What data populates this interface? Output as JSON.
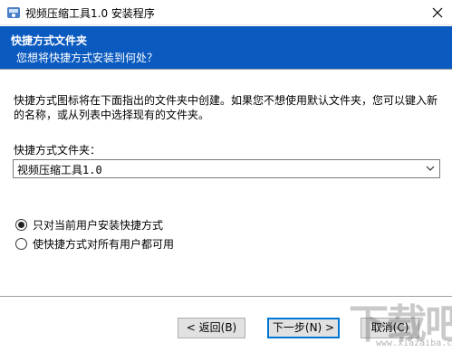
{
  "window": {
    "title": "视频压缩工具1.0 安装程序"
  },
  "header": {
    "title": "快捷方式文件夹",
    "subtitle": "您想将快捷方式安装到何处？",
    "background_color": "#0a5abf"
  },
  "body": {
    "description": "快捷方式图标将在下面指出的文件夹中创建。如果您不想使用默认文件夹，您可以键入新的名称，或从列表中选择现有的文件夹。",
    "folder_label": "快捷方式文件夹：",
    "folder_value": "视频压缩工具1.0",
    "radio_options": [
      {
        "label": "只对当前用户安装快捷方式",
        "checked": true
      },
      {
        "label": "使快捷方式对所有用户都可用",
        "checked": false
      }
    ]
  },
  "buttons": {
    "back": "< 返回(B)",
    "next": "下一步(N) >",
    "cancel": "取消(C)"
  },
  "watermark": {
    "text": "下载吧",
    "url": "www.xiazaiba.com"
  },
  "icons": {
    "app": "installer-app-icon",
    "close": "close-icon",
    "dropdown": "chevron-down-icon"
  }
}
